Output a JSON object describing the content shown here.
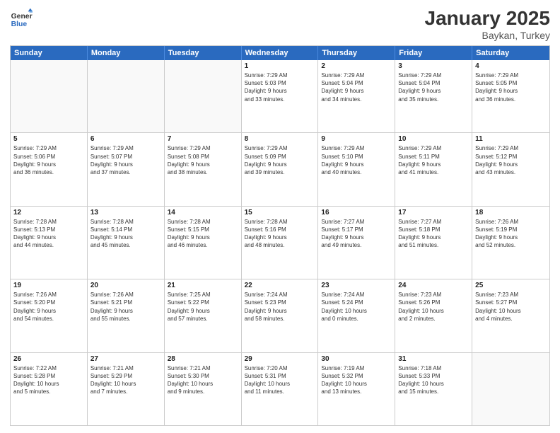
{
  "logo": {
    "general": "General",
    "blue": "Blue"
  },
  "header": {
    "month": "January 2025",
    "location": "Baykan, Turkey"
  },
  "weekdays": [
    "Sunday",
    "Monday",
    "Tuesday",
    "Wednesday",
    "Thursday",
    "Friday",
    "Saturday"
  ],
  "rows": [
    [
      {
        "day": "",
        "lines": []
      },
      {
        "day": "",
        "lines": []
      },
      {
        "day": "",
        "lines": []
      },
      {
        "day": "1",
        "lines": [
          "Sunrise: 7:29 AM",
          "Sunset: 5:03 PM",
          "Daylight: 9 hours",
          "and 33 minutes."
        ]
      },
      {
        "day": "2",
        "lines": [
          "Sunrise: 7:29 AM",
          "Sunset: 5:04 PM",
          "Daylight: 9 hours",
          "and 34 minutes."
        ]
      },
      {
        "day": "3",
        "lines": [
          "Sunrise: 7:29 AM",
          "Sunset: 5:04 PM",
          "Daylight: 9 hours",
          "and 35 minutes."
        ]
      },
      {
        "day": "4",
        "lines": [
          "Sunrise: 7:29 AM",
          "Sunset: 5:05 PM",
          "Daylight: 9 hours",
          "and 36 minutes."
        ]
      }
    ],
    [
      {
        "day": "5",
        "lines": [
          "Sunrise: 7:29 AM",
          "Sunset: 5:06 PM",
          "Daylight: 9 hours",
          "and 36 minutes."
        ]
      },
      {
        "day": "6",
        "lines": [
          "Sunrise: 7:29 AM",
          "Sunset: 5:07 PM",
          "Daylight: 9 hours",
          "and 37 minutes."
        ]
      },
      {
        "day": "7",
        "lines": [
          "Sunrise: 7:29 AM",
          "Sunset: 5:08 PM",
          "Daylight: 9 hours",
          "and 38 minutes."
        ]
      },
      {
        "day": "8",
        "lines": [
          "Sunrise: 7:29 AM",
          "Sunset: 5:09 PM",
          "Daylight: 9 hours",
          "and 39 minutes."
        ]
      },
      {
        "day": "9",
        "lines": [
          "Sunrise: 7:29 AM",
          "Sunset: 5:10 PM",
          "Daylight: 9 hours",
          "and 40 minutes."
        ]
      },
      {
        "day": "10",
        "lines": [
          "Sunrise: 7:29 AM",
          "Sunset: 5:11 PM",
          "Daylight: 9 hours",
          "and 41 minutes."
        ]
      },
      {
        "day": "11",
        "lines": [
          "Sunrise: 7:29 AM",
          "Sunset: 5:12 PM",
          "Daylight: 9 hours",
          "and 43 minutes."
        ]
      }
    ],
    [
      {
        "day": "12",
        "lines": [
          "Sunrise: 7:28 AM",
          "Sunset: 5:13 PM",
          "Daylight: 9 hours",
          "and 44 minutes."
        ]
      },
      {
        "day": "13",
        "lines": [
          "Sunrise: 7:28 AM",
          "Sunset: 5:14 PM",
          "Daylight: 9 hours",
          "and 45 minutes."
        ]
      },
      {
        "day": "14",
        "lines": [
          "Sunrise: 7:28 AM",
          "Sunset: 5:15 PM",
          "Daylight: 9 hours",
          "and 46 minutes."
        ]
      },
      {
        "day": "15",
        "lines": [
          "Sunrise: 7:28 AM",
          "Sunset: 5:16 PM",
          "Daylight: 9 hours",
          "and 48 minutes."
        ]
      },
      {
        "day": "16",
        "lines": [
          "Sunrise: 7:27 AM",
          "Sunset: 5:17 PM",
          "Daylight: 9 hours",
          "and 49 minutes."
        ]
      },
      {
        "day": "17",
        "lines": [
          "Sunrise: 7:27 AM",
          "Sunset: 5:18 PM",
          "Daylight: 9 hours",
          "and 51 minutes."
        ]
      },
      {
        "day": "18",
        "lines": [
          "Sunrise: 7:26 AM",
          "Sunset: 5:19 PM",
          "Daylight: 9 hours",
          "and 52 minutes."
        ]
      }
    ],
    [
      {
        "day": "19",
        "lines": [
          "Sunrise: 7:26 AM",
          "Sunset: 5:20 PM",
          "Daylight: 9 hours",
          "and 54 minutes."
        ]
      },
      {
        "day": "20",
        "lines": [
          "Sunrise: 7:26 AM",
          "Sunset: 5:21 PM",
          "Daylight: 9 hours",
          "and 55 minutes."
        ]
      },
      {
        "day": "21",
        "lines": [
          "Sunrise: 7:25 AM",
          "Sunset: 5:22 PM",
          "Daylight: 9 hours",
          "and 57 minutes."
        ]
      },
      {
        "day": "22",
        "lines": [
          "Sunrise: 7:24 AM",
          "Sunset: 5:23 PM",
          "Daylight: 9 hours",
          "and 58 minutes."
        ]
      },
      {
        "day": "23",
        "lines": [
          "Sunrise: 7:24 AM",
          "Sunset: 5:24 PM",
          "Daylight: 10 hours",
          "and 0 minutes."
        ]
      },
      {
        "day": "24",
        "lines": [
          "Sunrise: 7:23 AM",
          "Sunset: 5:26 PM",
          "Daylight: 10 hours",
          "and 2 minutes."
        ]
      },
      {
        "day": "25",
        "lines": [
          "Sunrise: 7:23 AM",
          "Sunset: 5:27 PM",
          "Daylight: 10 hours",
          "and 4 minutes."
        ]
      }
    ],
    [
      {
        "day": "26",
        "lines": [
          "Sunrise: 7:22 AM",
          "Sunset: 5:28 PM",
          "Daylight: 10 hours",
          "and 5 minutes."
        ]
      },
      {
        "day": "27",
        "lines": [
          "Sunrise: 7:21 AM",
          "Sunset: 5:29 PM",
          "Daylight: 10 hours",
          "and 7 minutes."
        ]
      },
      {
        "day": "28",
        "lines": [
          "Sunrise: 7:21 AM",
          "Sunset: 5:30 PM",
          "Daylight: 10 hours",
          "and 9 minutes."
        ]
      },
      {
        "day": "29",
        "lines": [
          "Sunrise: 7:20 AM",
          "Sunset: 5:31 PM",
          "Daylight: 10 hours",
          "and 11 minutes."
        ]
      },
      {
        "day": "30",
        "lines": [
          "Sunrise: 7:19 AM",
          "Sunset: 5:32 PM",
          "Daylight: 10 hours",
          "and 13 minutes."
        ]
      },
      {
        "day": "31",
        "lines": [
          "Sunrise: 7:18 AM",
          "Sunset: 5:33 PM",
          "Daylight: 10 hours",
          "and 15 minutes."
        ]
      },
      {
        "day": "",
        "lines": []
      }
    ]
  ]
}
